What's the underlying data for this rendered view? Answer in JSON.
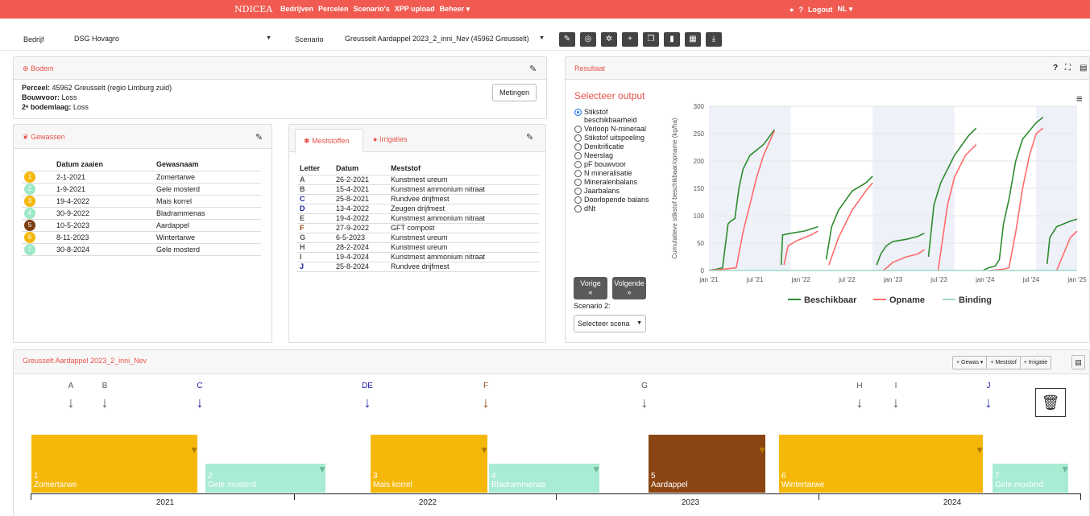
{
  "topbar": {
    "brand": "NDICEA",
    "nav": [
      "Bedrijven",
      "Percelen",
      "Scenario's",
      "XPP upload",
      "Beheer ▾"
    ],
    "logout": "Logout",
    "lang": "NL ▾"
  },
  "selector": {
    "bedrijf_label": "Bedrijf",
    "bedrijf_value": "DSG Hovagro",
    "scenario_label": "Scenario",
    "scenario_value": "Greusselt Aardappel 2023_2_inni_Nev (45962 Greusselt)"
  },
  "bodem": {
    "title": "Bodem",
    "perceel_label": "Perceel:",
    "perceel_value": "45962 Greusselt (regio Limburg zuid)",
    "bouwvoor_label": "Bouwvoor:",
    "bouwvoor_value": "Loss",
    "bodemlaag_label": "2ᵉ bodemlaag:",
    "bodemlaag_value": "Loss",
    "metingen": "Metingen"
  },
  "gewassen": {
    "title": "Gewassen",
    "headers": [
      "Datum zaaien",
      "Gewasnaam"
    ],
    "rows": [
      {
        "n": "1",
        "date": "2-1-2021",
        "name": "Zomertarwe",
        "color": "#f5b80a"
      },
      {
        "n": "2",
        "date": "1-9-2021",
        "name": "Gele mosterd",
        "color": "#9ee8c8"
      },
      {
        "n": "3",
        "date": "19-4-2022",
        "name": "Mais korrel",
        "color": "#f5b80a"
      },
      {
        "n": "4",
        "date": "30-9-2022",
        "name": "Bladrammenas",
        "color": "#9ee8c8"
      },
      {
        "n": "5",
        "date": "10-5-2023",
        "name": "Aardappel",
        "color": "#7b3f12"
      },
      {
        "n": "6",
        "date": "8-11-2023",
        "name": "Wintertarwe",
        "color": "#f5b80a"
      },
      {
        "n": "7",
        "date": "30-8-2024",
        "name": "Gele mosterd",
        "color": "#9ee8c8"
      }
    ]
  },
  "meststoffen": {
    "tab1": "Meststoffen",
    "tab2": "Irrigaties",
    "headers": [
      "Letter",
      "Datum",
      "Meststof"
    ],
    "rows": [
      {
        "l": "A",
        "date": "26-2-2021",
        "name": "Kunstmest ureum",
        "color": "#555"
      },
      {
        "l": "B",
        "date": "15-4-2021",
        "name": "Kunstmest ammonium nitraat",
        "color": "#555"
      },
      {
        "l": "C",
        "date": "25-8-2021",
        "name": "Rundvee drijfmest",
        "color": "#1a1aa0"
      },
      {
        "l": "D",
        "date": "13-4-2022",
        "name": "Zeugen drijfmest",
        "color": "#1a1aa0"
      },
      {
        "l": "E",
        "date": "19-4-2022",
        "name": "Kunstmest ammonium nitraat",
        "color": "#555"
      },
      {
        "l": "F",
        "date": "27-9-2022",
        "name": "GFT compost",
        "color": "#8b4513"
      },
      {
        "l": "G",
        "date": "6-5-2023",
        "name": "Kunstmest ureum",
        "color": "#555"
      },
      {
        "l": "H",
        "date": "28-2-2024",
        "name": "Kunstmest ureum",
        "color": "#555"
      },
      {
        "l": "I",
        "date": "19-4-2024",
        "name": "Kunstmest ammonium nitraat",
        "color": "#555"
      },
      {
        "l": "J",
        "date": "25-8-2024",
        "name": "Rundvee drijfmest",
        "color": "#1a1aa0"
      }
    ]
  },
  "resultaat": {
    "title": "Resultaat",
    "select_output": "Selecteer output",
    "options": [
      {
        "label": "Stikstof beschikbaarheid",
        "on": true
      },
      {
        "label": "Verloop N-mineraal",
        "on": false
      },
      {
        "label": "Stikstof uitspoeling",
        "on": false
      },
      {
        "label": "Denitrificatie",
        "on": false
      },
      {
        "label": "Neerslag",
        "on": false
      },
      {
        "label": "pF bouwvoor",
        "on": false
      },
      {
        "label": "N mineralisatie",
        "on": false
      },
      {
        "label": "Mineralenbalans",
        "on": false
      },
      {
        "label": "Jaarbalans",
        "on": false
      },
      {
        "label": "Doorlopende balans",
        "on": false
      },
      {
        "label": "dNt",
        "on": false
      }
    ],
    "vorige": "Vorige",
    "volgende": "Volgende",
    "scenario2_label": "Scenario 2:",
    "scenario2_value": "Selecteer scena"
  },
  "chart_data": {
    "type": "line",
    "ylabel": "Cumulatieve stikstof beschikbaar/opname (kg/ha)",
    "ylim": [
      0,
      300
    ],
    "yticks": [
      "0",
      "50",
      "100",
      "150",
      "200",
      "250",
      "300"
    ],
    "xticks": [
      "jan '21",
      "jul '21",
      "jan '22",
      "jul '22",
      "jan '23",
      "jul '23",
      "jan '24",
      "jul '24",
      "jan '25"
    ],
    "legend": [
      "Beschikbaar",
      "Opname",
      "Binding"
    ],
    "series": [
      {
        "name": "Beschikbaar",
        "color": "#2e8b2e",
        "segments": [
          [
            [
              0.0,
              0
            ],
            [
              0.5,
              2
            ],
            [
              1.0,
              5
            ],
            [
              1.4,
              85
            ],
            [
              1.6,
              90
            ],
            [
              1.9,
              95
            ],
            [
              2.2,
              150
            ],
            [
              2.5,
              185
            ],
            [
              3.0,
              210
            ],
            [
              4.0,
              230
            ],
            [
              4.8,
              257
            ]
          ],
          [
            [
              5.3,
              10
            ],
            [
              5.4,
              65
            ],
            [
              6.0,
              68
            ],
            [
              7.0,
              72
            ],
            [
              8.0,
              80
            ]
          ],
          [
            [
              8.6,
              20
            ],
            [
              9.0,
              80
            ],
            [
              9.5,
              110
            ],
            [
              10.5,
              145
            ],
            [
              11.5,
              160
            ],
            [
              12.0,
              172
            ]
          ],
          [
            [
              12.3,
              10
            ],
            [
              12.6,
              30
            ],
            [
              13.0,
              45
            ],
            [
              13.5,
              53
            ],
            [
              14.5,
              57
            ],
            [
              15.3,
              62
            ],
            [
              15.8,
              68
            ]
          ],
          [
            [
              16.1,
              25
            ],
            [
              16.5,
              120
            ],
            [
              17.0,
              160
            ],
            [
              18.0,
              210
            ],
            [
              19.0,
              245
            ],
            [
              19.6,
              260
            ]
          ],
          [
            [
              20.1,
              0
            ],
            [
              20.5,
              5
            ],
            [
              21.0,
              8
            ],
            [
              21.3,
              20
            ],
            [
              21.6,
              85
            ],
            [
              22.0,
              130
            ],
            [
              22.5,
              200
            ],
            [
              23.0,
              240
            ],
            [
              24.0,
              270
            ],
            [
              24.5,
              280
            ]
          ],
          [
            [
              24.8,
              12
            ],
            [
              25.0,
              60
            ],
            [
              25.5,
              80
            ],
            [
              26.5,
              90
            ],
            [
              27.0,
              94
            ]
          ]
        ]
      },
      {
        "name": "Opname",
        "color": "#ff6b6b",
        "segments": [
          [
            [
              0.0,
              0
            ],
            [
              1.0,
              2
            ],
            [
              2.0,
              5
            ],
            [
              2.5,
              70
            ],
            [
              3.0,
              120
            ],
            [
              3.5,
              170
            ],
            [
              4.0,
              210
            ],
            [
              4.8,
              255
            ]
          ],
          [
            [
              5.5,
              10
            ],
            [
              5.8,
              45
            ],
            [
              6.5,
              55
            ],
            [
              7.5,
              65
            ],
            [
              8.0,
              72
            ]
          ],
          [
            [
              8.8,
              10
            ],
            [
              9.5,
              60
            ],
            [
              10.5,
              110
            ],
            [
              11.5,
              145
            ],
            [
              12.0,
              160
            ]
          ],
          [
            [
              12.8,
              0
            ],
            [
              13.5,
              15
            ],
            [
              14.5,
              25
            ],
            [
              15.3,
              30
            ],
            [
              15.8,
              38
            ]
          ],
          [
            [
              16.8,
              0
            ],
            [
              17.5,
              120
            ],
            [
              18.0,
              170
            ],
            [
              18.8,
              210
            ],
            [
              19.6,
              230
            ]
          ],
          [
            [
              20.5,
              0
            ],
            [
              21.5,
              2
            ],
            [
              22.0,
              5
            ],
            [
              22.5,
              70
            ],
            [
              23.0,
              150
            ],
            [
              23.5,
              210
            ],
            [
              24.0,
              250
            ],
            [
              24.5,
              260
            ]
          ],
          [
            [
              25.5,
              0
            ],
            [
              26.0,
              30
            ],
            [
              26.5,
              60
            ],
            [
              27.0,
              72
            ]
          ]
        ]
      },
      {
        "name": "Binding",
        "color": "#9ed8c8",
        "segments": [
          [
            [
              0.0,
              0
            ],
            [
              27.0,
              0
            ]
          ]
        ]
      }
    ]
  },
  "timeline": {
    "title": "Greusselt Aardappel 2023_2_inni_Nev",
    "add_gewas": "+ Gewas ▾",
    "add_meststof": "+ Meststof",
    "add_irrigatie": "+ Irrigatie",
    "years": [
      "2021",
      "2022",
      "2023",
      "2024"
    ],
    "fert_labels": [
      "A",
      "B",
      "C",
      "DE",
      "F",
      "G",
      "H",
      "I",
      "J"
    ],
    "crops": [
      {
        "n": "1",
        "name": "Zomertarwe"
      },
      {
        "n": "2",
        "name": "Gele mosterd"
      },
      {
        "n": "3",
        "name": "Mais korrel"
      },
      {
        "n": "4",
        "name": "Bladrammenas"
      },
      {
        "n": "5",
        "name": "Aardappel"
      },
      {
        "n": "6",
        "name": "Wintertarwe"
      },
      {
        "n": "7",
        "name": "Gele mosterd"
      }
    ]
  }
}
